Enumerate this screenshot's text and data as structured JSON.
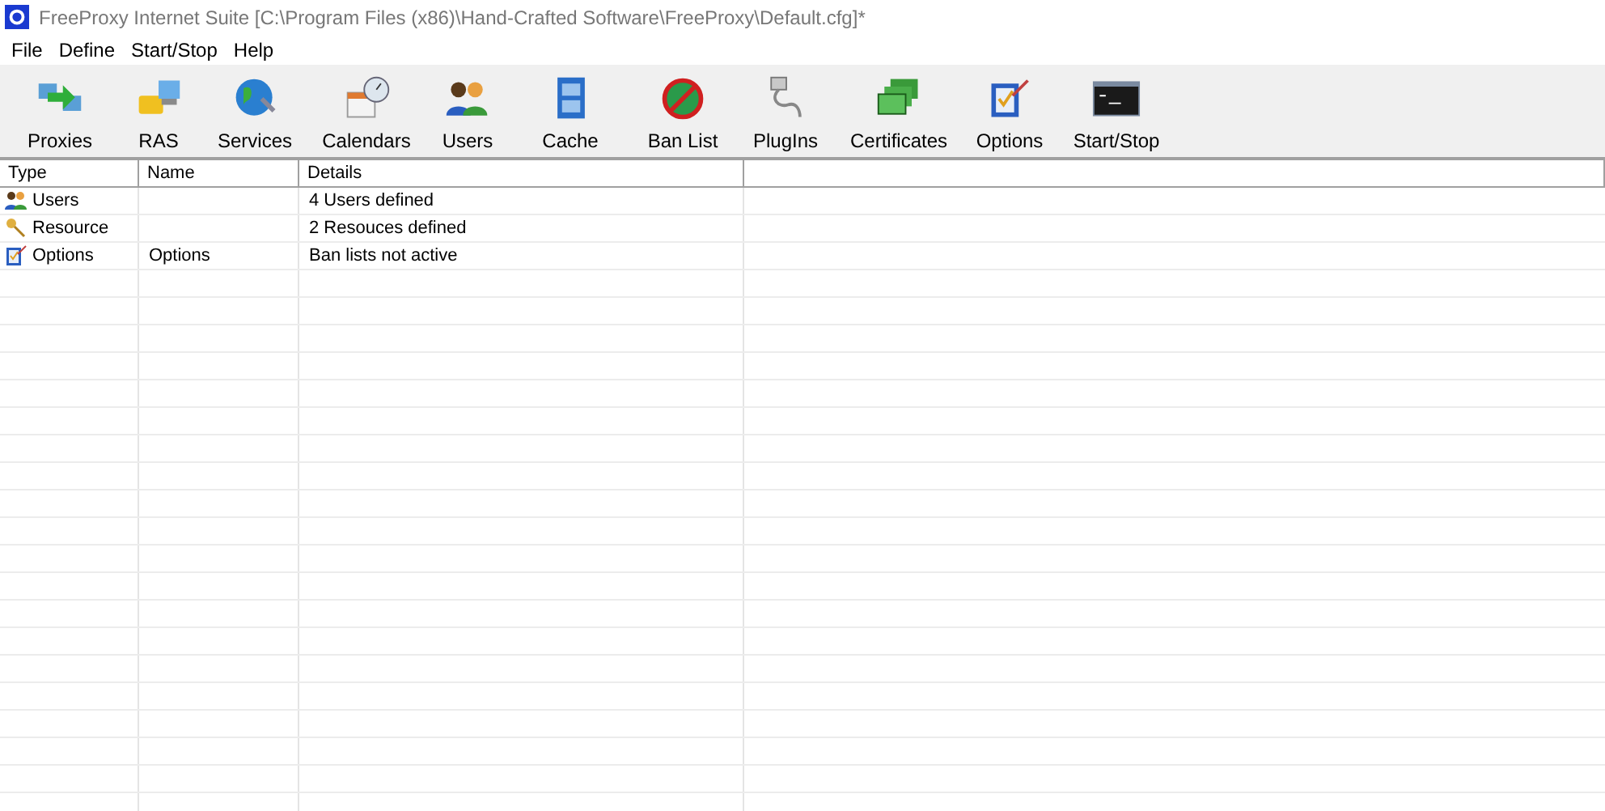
{
  "window": {
    "title": "FreeProxy Internet Suite [C:\\Program Files (x86)\\Hand-Crafted Software\\FreeProxy\\Default.cfg]*"
  },
  "menu": [
    "File",
    "Define",
    "Start/Stop",
    "Help"
  ],
  "toolbar": [
    {
      "label": "Proxies",
      "kind": "proxies"
    },
    {
      "label": "RAS",
      "kind": "ras"
    },
    {
      "label": "Services",
      "kind": "globe"
    },
    {
      "label": "Calendars",
      "kind": "calendar"
    },
    {
      "label": "Users",
      "kind": "users"
    },
    {
      "label": "Cache",
      "kind": "cabinet"
    },
    {
      "label": "Ban List",
      "kind": "ban"
    },
    {
      "label": "PlugIns",
      "kind": "plug"
    },
    {
      "label": "Certificates",
      "kind": "certificate"
    },
    {
      "label": "Options",
      "kind": "options"
    },
    {
      "label": "Start/Stop",
      "kind": "console"
    }
  ],
  "table": {
    "columns": [
      "Type",
      "Name",
      "Details"
    ],
    "rows": [
      {
        "kind": "users",
        "type": "Users",
        "details": "4 Users defined"
      },
      {
        "kind": "keys",
        "type": "Resource",
        "details": "2 Resouces defined"
      },
      {
        "kind": "options",
        "type": "Options",
        "name": "Options",
        "details": "Ban lists not active"
      }
    ]
  }
}
